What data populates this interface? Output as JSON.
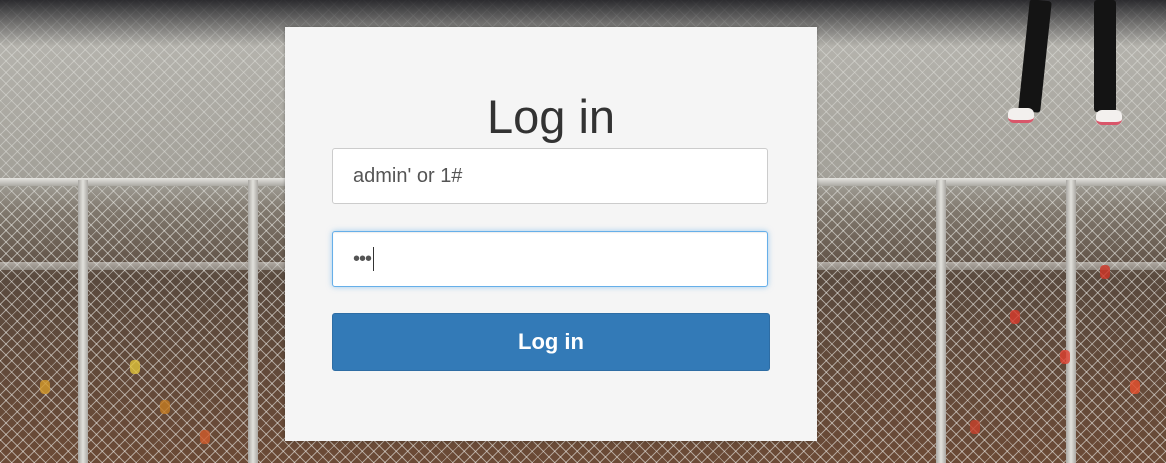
{
  "login": {
    "title": "Log in",
    "username_value": "admin' or 1#",
    "password_masked": "•••",
    "submit_label": "Log in"
  },
  "colors": {
    "button": "#337ab7",
    "panel": "#f5f5f5",
    "focus_border": "#66afe9"
  }
}
